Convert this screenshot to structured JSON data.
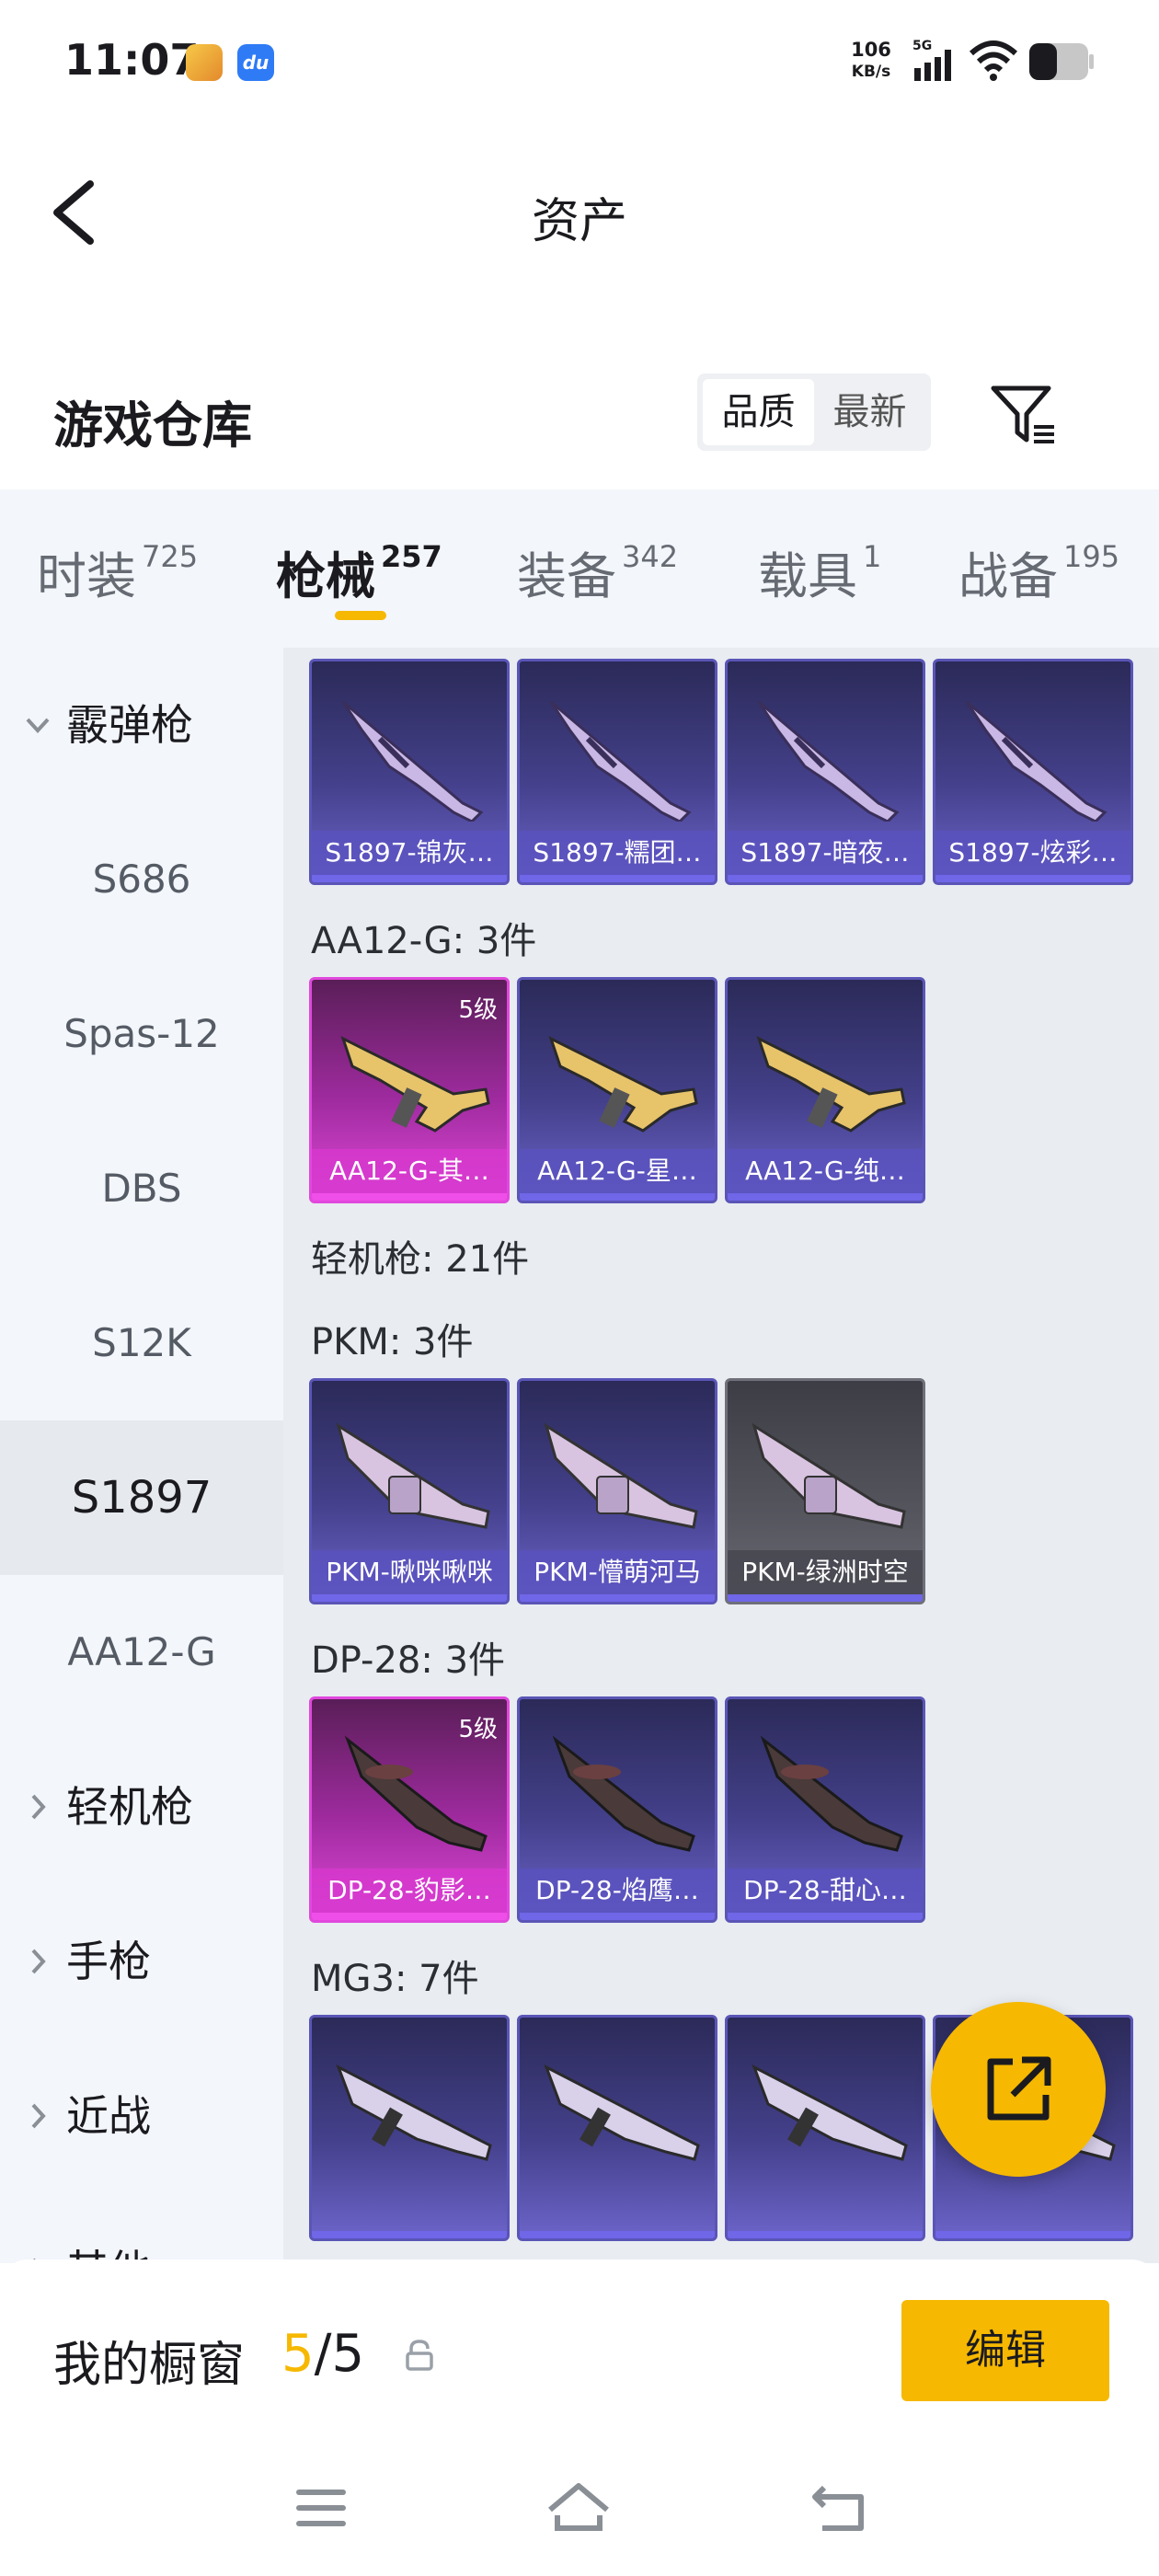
{
  "status_bar": {
    "time": "11:07",
    "net_speed_value": "106",
    "net_speed_unit": "KB/s",
    "network": "5G",
    "icons": [
      "game-app-icon",
      "du-app-icon",
      "signal-icon",
      "wifi-icon",
      "battery-icon"
    ]
  },
  "header": {
    "title": "资产",
    "back_icon": "chevron-left-icon"
  },
  "warehouse": {
    "title": "游戏仓库",
    "sort_options": [
      "品质",
      "最新"
    ],
    "sort_selected": "品质",
    "filter_icon": "filter-icon"
  },
  "tabs": [
    {
      "label": "时装",
      "count": "725"
    },
    {
      "label": "枪械",
      "count": "257"
    },
    {
      "label": "装备",
      "count": "342"
    },
    {
      "label": "载具",
      "count": "1"
    },
    {
      "label": "战备",
      "count": "195"
    }
  ],
  "active_tab": "枪械",
  "sidebar": {
    "items": [
      {
        "label": "霰弹枪",
        "kind": "group-open"
      },
      {
        "label": "S686",
        "kind": "sub"
      },
      {
        "label": "Spas-12",
        "kind": "sub"
      },
      {
        "label": "DBS",
        "kind": "sub"
      },
      {
        "label": "S12K",
        "kind": "sub"
      },
      {
        "label": "S1897",
        "kind": "sub-selected"
      },
      {
        "label": "AA12-G",
        "kind": "sub"
      },
      {
        "label": "轻机枪",
        "kind": "group-closed"
      },
      {
        "label": "手枪",
        "kind": "group-closed"
      },
      {
        "label": "近战",
        "kind": "group-closed"
      },
      {
        "label": "其他",
        "kind": "group-closed"
      }
    ]
  },
  "content": {
    "sections": [
      {
        "label": "",
        "items": [
          {
            "name": "S1897-锦灰…",
            "rarity": "purple",
            "weapon": "shotgun"
          },
          {
            "name": "S1897-糯团…",
            "rarity": "purple",
            "weapon": "shotgun"
          },
          {
            "name": "S1897-暗夜…",
            "rarity": "purple",
            "weapon": "shotgun"
          },
          {
            "name": "S1897-炫彩…",
            "rarity": "purple",
            "weapon": "shotgun"
          }
        ]
      },
      {
        "label": "AA12-G: 3件",
        "items": [
          {
            "name": "AA12-G-其…",
            "rarity": "gold",
            "level": "5级",
            "weapon": "rifle"
          },
          {
            "name": "AA12-G-星…",
            "rarity": "purple",
            "weapon": "rifle"
          },
          {
            "name": "AA12-G-纯…",
            "rarity": "purple",
            "weapon": "rifle"
          }
        ]
      },
      {
        "label": "轻机枪: 21件",
        "items": []
      },
      {
        "label": "PKM: 3件",
        "items": [
          {
            "name": "PKM-啾咪啾咪",
            "rarity": "purple",
            "weapon": "lmg"
          },
          {
            "name": "PKM-懵萌河马",
            "rarity": "purple",
            "weapon": "lmg"
          },
          {
            "name": "PKM-绿洲时空",
            "rarity": "gray",
            "weapon": "lmg"
          }
        ]
      },
      {
        "label": "DP-28: 3件",
        "items": [
          {
            "name": "DP-28-豹影…",
            "rarity": "gold",
            "level": "5级",
            "weapon": "dp"
          },
          {
            "name": "DP-28-焰鹰…",
            "rarity": "purple",
            "weapon": "dp"
          },
          {
            "name": "DP-28-甜心…",
            "rarity": "purple",
            "weapon": "dp"
          }
        ]
      },
      {
        "label": "MG3: 7件",
        "items": [
          {
            "name": "",
            "rarity": "purple",
            "weapon": "mg"
          },
          {
            "name": "",
            "rarity": "purple",
            "weapon": "mg"
          },
          {
            "name": "",
            "rarity": "purple",
            "weapon": "mg"
          },
          {
            "name": "",
            "rarity": "purple",
            "weapon": "mg"
          }
        ]
      }
    ]
  },
  "fab": {
    "icon": "share-icon"
  },
  "bottom_bar": {
    "label": "我的橱窗",
    "count_current": "5",
    "count_sep": "/",
    "count_total": "5",
    "lock_icon": "lock-icon",
    "edit_label": "编辑"
  },
  "system_nav": {
    "icons": [
      "menu-icon",
      "home-icon",
      "back-icon"
    ]
  },
  "colors": {
    "accent": "#f6b800",
    "purple": "#5a55b6",
    "gold": "#e048dc",
    "panel": "#f3f6fb"
  }
}
